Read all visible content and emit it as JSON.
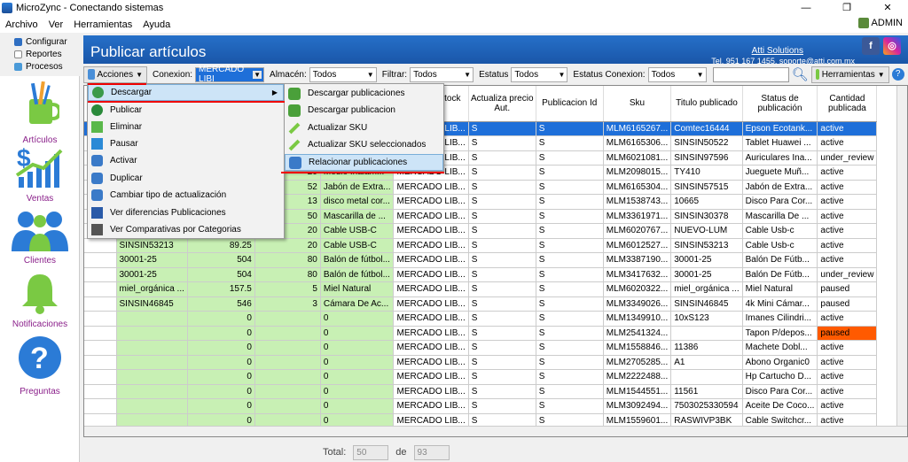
{
  "window": {
    "title": "MicroZync - Conectando sistemas",
    "min": "—",
    "max": "❐",
    "close": "✕"
  },
  "menubar": {
    "items": [
      "Archivo",
      "Ver",
      "Herramientas",
      "Ayuda"
    ],
    "user": "ADMIN"
  },
  "lefttabs": [
    "Configurar",
    "Reportes",
    "Procesos"
  ],
  "sidebar": [
    "Artículos",
    "Ventas",
    "Clientes",
    "Notificaciones",
    "Preguntas"
  ],
  "header": {
    "title": "Publicar artículos",
    "company": "Atti Solutions",
    "contact": "Tel. 951 167 1455, soporte@atti.com.mx"
  },
  "toolbar": {
    "acciones": "Acciones",
    "conexion_label": "Conexion:",
    "conexion_value": "MERCADO LIBI",
    "almacen_label": "Almacén:",
    "almacen_value": "Todos",
    "filtrar_label": "Filtrar:",
    "filtrar_value": "Todos",
    "estatus_label": "Estatus",
    "estatus_value": "Todos",
    "estatus_conexion_label": "Estatus Conexion:",
    "estatus_conexion_value": "Todos",
    "herramientas": "Herramientas"
  },
  "menu": {
    "items": [
      "Descargar",
      "Publicar",
      "Eliminar",
      "Pausar",
      "Activar",
      "Duplicar",
      "Cambiar tipo de actualización",
      "Ver diferencias Publicaciones",
      "Ver Comparativas por Categorias"
    ],
    "submenu": [
      "Descargar publicaciones",
      "Descargar publicacion",
      "Actualizar SKU",
      "Actualizar SKU seleccionados",
      "Relacionar publicaciones"
    ]
  },
  "grid": {
    "headers": [
      "",
      "",
      "",
      "",
      "",
      "Actualiza stock Aut.",
      "Actualiza precio Aut.",
      "Publicacion Id",
      "Sku",
      "Titulo publicado",
      "Status de publicación",
      "Cantidad publicada"
    ],
    "rows": [
      [
        "",
        "",
        "",
        "",
        "",
        "S",
        "S",
        "MLM6165267...",
        "Comtec16444",
        "Epson Ecotank...",
        "active",
        ""
      ],
      [
        "",
        "",
        "",
        "",
        "",
        "S",
        "S",
        "MLM6165306...",
        "SINSIN50522",
        "Tablet Huawei ...",
        "active",
        ""
      ],
      [
        "",
        "",
        "",
        "",
        "",
        "S",
        "S",
        "MLM6021081...",
        "SINSIN97596",
        "Auriculares Ina...",
        "under_review",
        ""
      ],
      [
        "",
        "",
        "",
        "20",
        "Medio Inalám...",
        "S",
        "S",
        "MLM2098015...",
        "TY410",
        "Jueguete Muñ...",
        "active",
        ""
      ],
      [
        "",
        "",
        "",
        "52",
        "Jabón de Extra...",
        "S",
        "S",
        "MLM6165304...",
        "SINSIN57515",
        "Jabón de Extra...",
        "active",
        ""
      ],
      [
        "",
        "",
        "",
        "13",
        "disco metal cor...",
        "S",
        "S",
        "MLM1538743...",
        "10665",
        "Disco Para Cor...",
        "active",
        ""
      ],
      [
        "",
        "",
        "",
        "50",
        "Mascarilla de ...",
        "S",
        "S",
        "MLM3361971...",
        "SINSIN30378",
        "Mascarilla De ...",
        "active",
        ""
      ],
      [
        "",
        "",
        "",
        "20",
        "Cable USB-C",
        "S",
        "S",
        "MLM6020767...",
        "NUEVO-LUM",
        "Cable Usb-c",
        "active",
        ""
      ],
      [
        "",
        "SINSIN53213",
        "89.25",
        "20",
        "Cable USB-C",
        "S",
        "S",
        "MLM6012527...",
        "SINSIN53213",
        "Cable Usb-c",
        "active",
        ""
      ],
      [
        "",
        "30001-25",
        "504",
        "80",
        "Balón de fútbol...",
        "S",
        "S",
        "MLM3387190...",
        "30001-25",
        "Balón De Fútb...",
        "active",
        ""
      ],
      [
        "",
        "30001-25",
        "504",
        "80",
        "Balón de fútbol...",
        "S",
        "S",
        "MLM3417632...",
        "30001-25",
        "Balón De Fútb...",
        "under_review",
        ""
      ],
      [
        "",
        "miel_orgánica ...",
        "157.5",
        "5",
        "Miel Natural",
        "S",
        "S",
        "MLM6020322...",
        "miel_orgánica ...",
        "Miel Natural",
        "paused",
        ""
      ],
      [
        "",
        "SINSIN46845",
        "546",
        "3",
        "Cámara De Ac...",
        "S",
        "S",
        "MLM3349026...",
        "SINSIN46845",
        "4k Mini Cámar...",
        "paused",
        ""
      ],
      [
        "",
        "",
        "0",
        "",
        "0",
        "S",
        "S",
        "MLM1349910...",
        "10xS123",
        "Imanes Cilindri...",
        "active",
        ""
      ],
      [
        "",
        "",
        "0",
        "",
        "0",
        "S",
        "S",
        "MLM2541324...",
        "",
        "Tapon P/depos...",
        "paused",
        ""
      ],
      [
        "",
        "",
        "0",
        "",
        "0",
        "S",
        "S",
        "MLM1558846...",
        "11386",
        "Machete Dobl...",
        "active",
        ""
      ],
      [
        "",
        "",
        "0",
        "",
        "0",
        "S",
        "S",
        "MLM2705285...",
        "A1",
        "Abono Organic0",
        "active",
        ""
      ],
      [
        "",
        "",
        "0",
        "",
        "0",
        "S",
        "S",
        "MLM2222488...",
        "",
        "Hp Cartucho D...",
        "active",
        ""
      ],
      [
        "",
        "",
        "0",
        "",
        "0",
        "S",
        "S",
        "MLM1544551...",
        "11561",
        "Disco Para Cor...",
        "active",
        ""
      ],
      [
        "",
        "",
        "0",
        "",
        "0",
        "S",
        "S",
        "MLM3092494...",
        "7503025330594",
        "Aceite De Coco...",
        "active",
        ""
      ],
      [
        "",
        "",
        "0",
        "",
        "0",
        "S",
        "S",
        "MLM1559601...",
        "RASWIVP3BK",
        "Cable Switchcr...",
        "active",
        ""
      ]
    ],
    "col4_label": "MERCADO LIB..."
  },
  "footer": {
    "total_label": "Total:",
    "shown": "50",
    "de_label": "de",
    "total": "93"
  },
  "colors": {
    "header": "#1a56a8",
    "selected": "#1e6fd9",
    "green": "#c8f0b4",
    "orange": "#ff5a00",
    "sidebar_text": "#8a1f8a"
  }
}
